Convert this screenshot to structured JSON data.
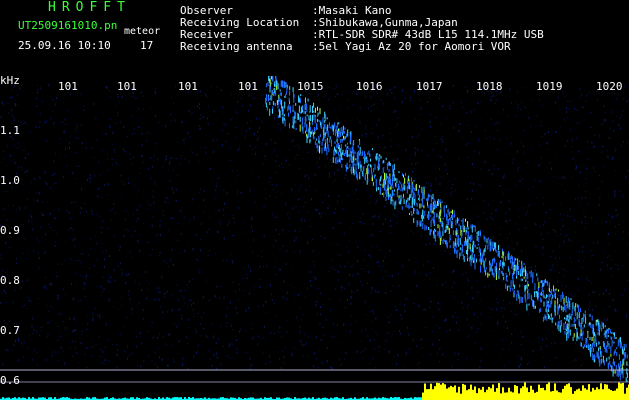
{
  "header": {
    "app_title": "HROFFT",
    "file_name": "UT2509161010.pn",
    "file_suffix": "meteor",
    "date_time": "25.09.16 10:10",
    "frame_count": "17",
    "fields": [
      {
        "label": "Observer",
        "value": ":Masaki Kano"
      },
      {
        "label": "Receiving Location",
        "value": ":Shibukawa,Gunma,Japan"
      },
      {
        "label": "Receiver",
        "value": ":RTL-SDR SDR# 43dB L15 114.1MHz USB"
      },
      {
        "label": "Receiving antenna",
        "value": ":5el Yagi Az 20 for Aomori VOR"
      }
    ]
  },
  "spectrogram": {
    "y_unit": "kHz",
    "y_ticks": [
      "1.1",
      "1.0",
      "0.9",
      "0.8",
      "0.7",
      "0.6"
    ],
    "x_ticks": [
      "101",
      "101",
      "101",
      "101",
      "1015",
      "1016",
      "1017",
      "1018",
      "1019",
      "1020"
    ],
    "colors": {
      "background": "#000000",
      "noise": "#0a1a6e",
      "trace": "#1e6cff",
      "trace_hot": "#3cd3ff",
      "peak": "#b8ff3c",
      "amplitude_yellow": "#ffff00",
      "amplitude_cyan": "#00ffff",
      "baseline": "#b0b0d0"
    }
  }
}
